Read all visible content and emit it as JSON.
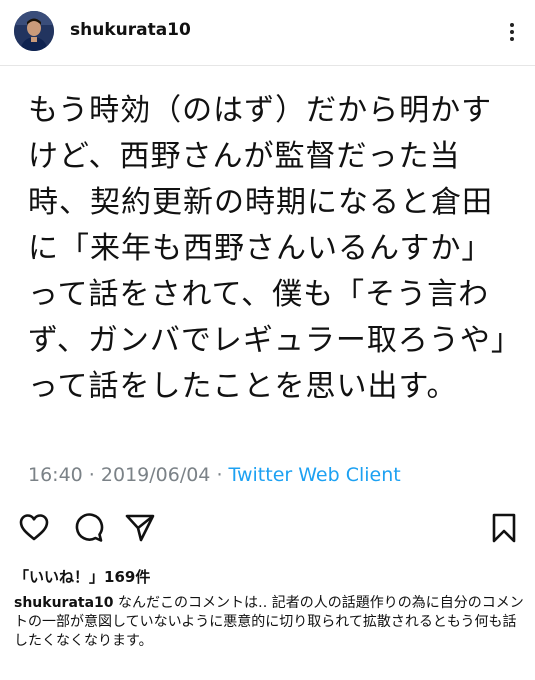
{
  "header": {
    "username": "shukurata10",
    "avatar_icon": "profile-photo",
    "more_icon": "more-options-icon"
  },
  "tweet": {
    "text": "もう時効（のはず）だから明かすけど、西野さんが監督だった当時、契約更新の時期になると倉田に「来年も西野さんいるんすか」って話をされて、僕も「そう言わず、ガンバでレギュラー取ろうや」って話をしたことを思い出す。",
    "time": "16:40",
    "separator1": " · ",
    "date": "2019/06/04",
    "separator2": " · ",
    "client": "Twitter Web Client"
  },
  "actions": {
    "like_icon": "heart-icon",
    "comment_icon": "comment-icon",
    "share_icon": "paper-plane-icon",
    "save_icon": "bookmark-icon"
  },
  "likes": {
    "label": "「いいね！」",
    "count": "169件"
  },
  "caption": {
    "username": "shukurata10",
    "text": " なんだこのコメントは‥ 記者の人の話題作りの為に自分のコメントの一部が意図していないように悪意的に切り取られて拡散されるともう何も話したくなくなります。"
  },
  "colors": {
    "text": "#111111",
    "meta_gray": "#7b8287",
    "link_blue": "#1da1f2",
    "divider": "#e6e6e6"
  }
}
